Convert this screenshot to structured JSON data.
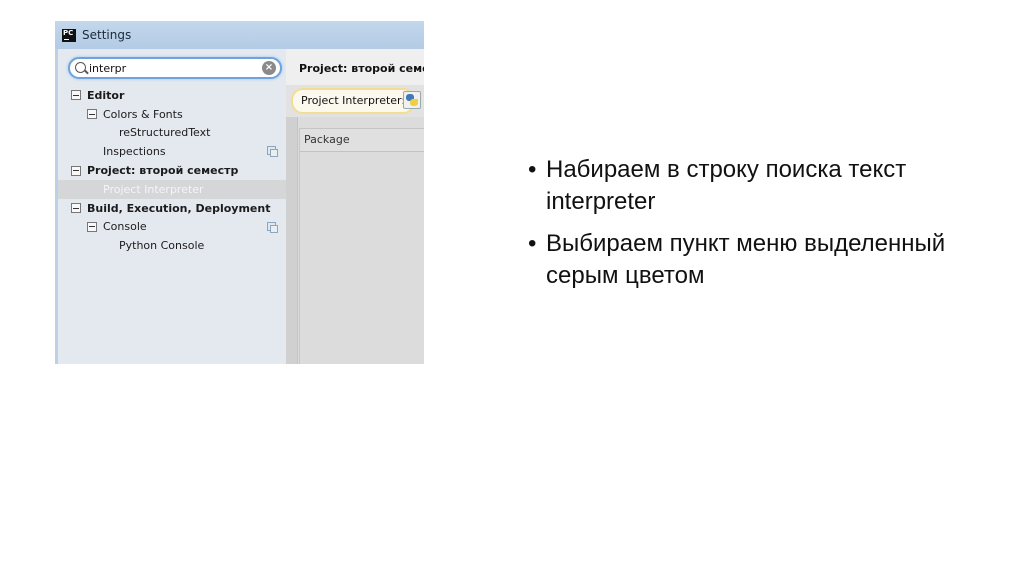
{
  "window": {
    "app_icon": "PC",
    "title": "Settings"
  },
  "search": {
    "value": "interpr",
    "placeholder": ""
  },
  "tree": [
    {
      "label": "Editor",
      "level": 0,
      "bold": true,
      "expanded": true
    },
    {
      "label": "Colors & Fonts",
      "level": 1,
      "bold": false,
      "expanded": true
    },
    {
      "label": "reStructuredText",
      "level": 2,
      "bold": false
    },
    {
      "label": "Inspections",
      "level": 1,
      "bold": false,
      "copy_icon": true
    },
    {
      "label": "Project: второй семестр",
      "level": 0,
      "bold": true,
      "expanded": true
    },
    {
      "label": "Project Interpreter",
      "level": 1,
      "bold": false,
      "selected": true
    },
    {
      "label": "Build, Execution, Deployment",
      "level": 0,
      "bold": true,
      "expanded": true
    },
    {
      "label": "Console",
      "level": 1,
      "bold": false,
      "expanded": true,
      "copy_icon": true
    },
    {
      "label": "Python Console",
      "level": 2,
      "bold": false
    }
  ],
  "main": {
    "title": "Project: второй семе",
    "interpreter_label": "Project Interpreter:",
    "table_header": "Package"
  },
  "bullets": [
    "Набираем в строку поиска текст interpreter",
    "Выбираем пункт меню выделенный серым цветом"
  ]
}
